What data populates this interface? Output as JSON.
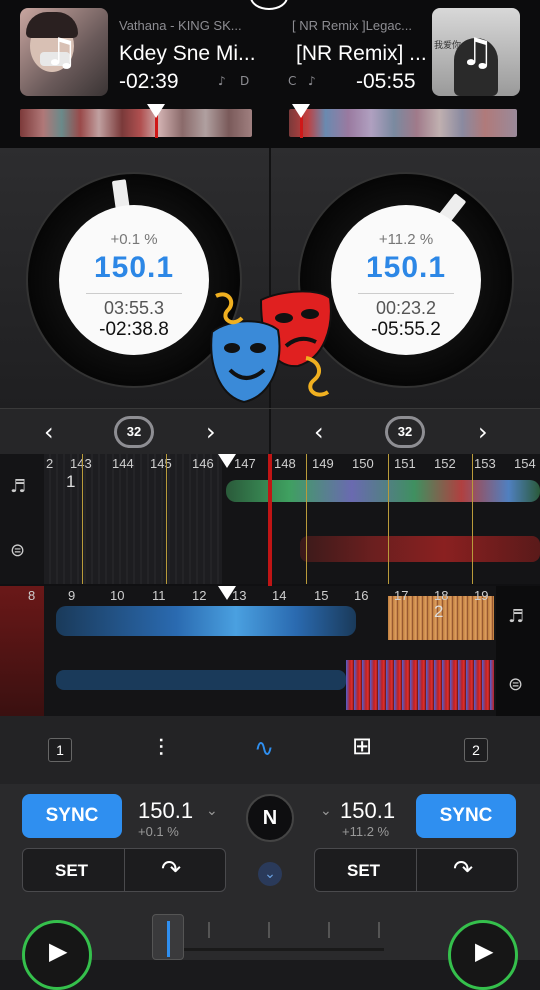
{
  "deck_a": {
    "artist": "Vathana - KING SK...",
    "title": "Kdey Sne Mi...",
    "remaining": "-02:39",
    "key_label": "D",
    "pitch": "+0.1 %",
    "bpm": "150.1",
    "elapsed": "03:55.3",
    "remaining_full": "-02:38.8",
    "loop_size": "32",
    "deck_number": "1",
    "bpm_small": "150.1",
    "pitch_small": "+0.1 %",
    "sync_label": "SYNC",
    "set_label": "SET"
  },
  "deck_b": {
    "artist": "[ NR Remix ]Legac...",
    "title": "[NR Remix] ...",
    "remaining": "-05:55",
    "key_label": "C",
    "pitch": "+11.2 %",
    "bpm": "150.1",
    "elapsed": "00:23.2",
    "remaining_full": "-05:55.2",
    "loop_size": "32",
    "deck_number": "2",
    "bpm_small": "150.1",
    "pitch_small": "+11.2 %",
    "sync_label": "SYNC",
    "set_label": "SET",
    "art_text": "我爱你"
  },
  "beats_top": [
    "2",
    "143",
    "144",
    "145",
    "146",
    "147",
    "148",
    "149",
    "150",
    "151",
    "152",
    "153",
    "154"
  ],
  "beats_bottom": [
    "8",
    "9",
    "10",
    "11",
    "12",
    "13",
    "14",
    "15",
    "16",
    "17",
    "18",
    "19"
  ],
  "cue_top": "1",
  "cue_bottom": "2",
  "center_button": "N",
  "colors": {
    "accent": "#2f8ff0",
    "play": "#35c04c",
    "playhead": "#d01818"
  }
}
